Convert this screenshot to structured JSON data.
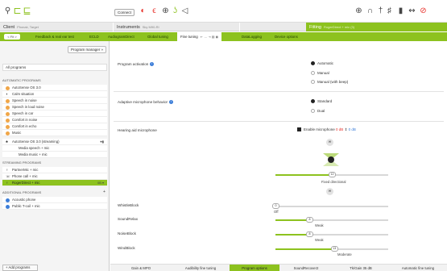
{
  "toolbar": {
    "connect_label": "Connect"
  },
  "infobar": {
    "client_label": "Client",
    "client_name": "Phonak, Target",
    "instruments_label": "Instruments",
    "instruments_sub": "Sky M90-RI",
    "fitting_label": "Fitting",
    "fitting_sub": "RogerDirect + mic (3)"
  },
  "tabs": {
    "nav_label": "< Fit >",
    "items": [
      "Feedback & real ear test",
      "ECLD",
      "AudiogramDirect",
      "Global tuning",
      "Fine tuning",
      "DataLogging",
      "Device options"
    ],
    "active_controls": "⇤ ↔ ⇥ ▦ ◼"
  },
  "sidebar": {
    "program_manager": "Program manager »",
    "all_programs": "All programs",
    "sections": {
      "automatic": "AUTOMATIC PROGRAMS",
      "streaming": "STREAMING PROGRAMS",
      "additional": "ADDITIONAL PROGRAMS"
    },
    "automatic": [
      "AutoSense OS 3.0",
      "Calm situation",
      "Speech in noise",
      "Speech in loud noise",
      "Speech in car",
      "Comfort in noise",
      "Comfort in echo",
      "Music"
    ],
    "streaming_group": "AutoSense OS 3.0 (streaming)",
    "streaming_sub": [
      "Media speech + mic",
      "Media music + mic"
    ],
    "streaming": [
      "PartnerMic + mic",
      "Phone call + mic",
      "RogerDirect + mic"
    ],
    "selected_control": "0B ▾",
    "additional": [
      "Acoustic phone",
      "Public T-coil + mic"
    ],
    "add_programs": "+ Add programs"
  },
  "main": {
    "program_activation": {
      "label": "Program activation",
      "options": [
        "Automatic",
        "Manual",
        "Manual (with beep)"
      ],
      "selected": "Automatic"
    },
    "adaptive_mic": {
      "label": "Adaptive microphone behavior",
      "options": [
        "Standard",
        "Dual"
      ],
      "selected": "Standard"
    },
    "hearing_aid_mic": {
      "label": "Hearing aid microphone",
      "enable_label": "Enable microphone",
      "left_value": "0 dB",
      "right_value": "0 dB",
      "slider_value": "12",
      "slider_caption": "Fixed directional",
      "slider_fraction": 0.5
    },
    "sliders": [
      {
        "label": "WhistleBlock",
        "value": "0",
        "caption": "Off",
        "fraction": 0.0
      },
      {
        "label": "SoundRelax",
        "value": "8",
        "caption": "Weak",
        "fraction": 0.3
      },
      {
        "label": "NoiseBlock",
        "value": "8",
        "caption": "Weak",
        "fraction": 0.3
      },
      {
        "label": "WindBlock",
        "value": "13",
        "caption": "Moderate",
        "fraction": 0.52
      }
    ]
  },
  "bottom": {
    "buttons": [
      "Gain & MPO",
      "Audibility fine tuning",
      "Program options",
      "SoundRecover2",
      "Tk/Gain 35 dB",
      "Automatic fine tuning"
    ],
    "active": "Program options"
  },
  "colors": {
    "accent": "#8dc21f",
    "alert": "#e8322c",
    "info": "#3b7dd8"
  }
}
